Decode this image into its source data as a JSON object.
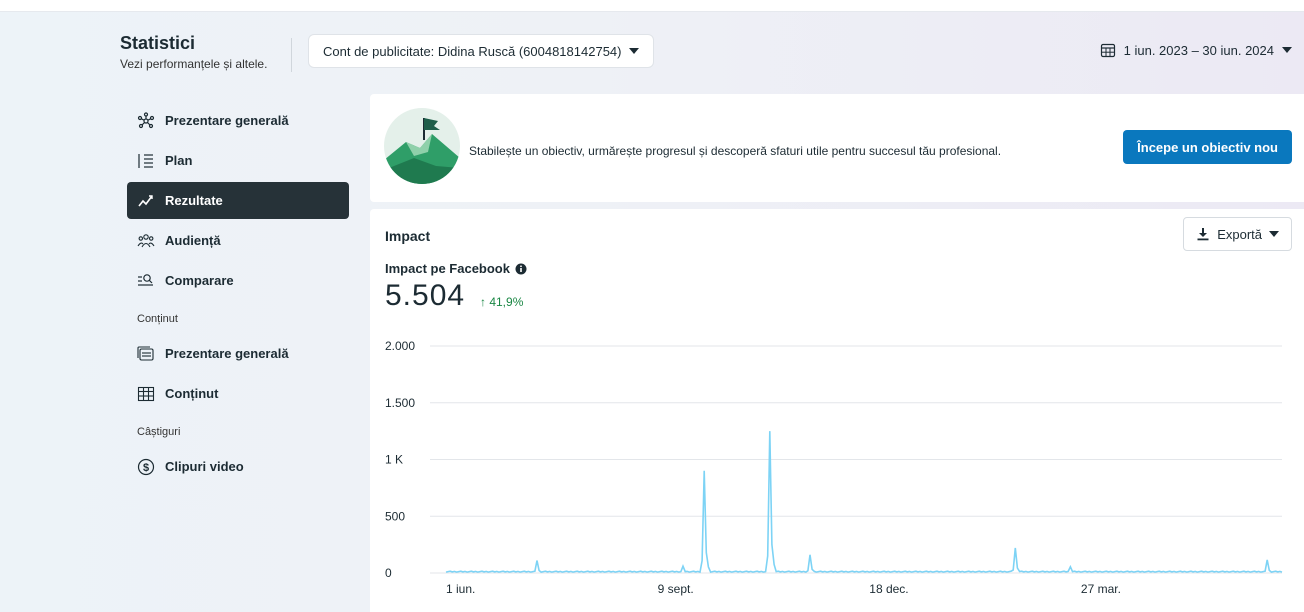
{
  "header": {
    "title": "Statistici",
    "subtitle": "Vezi performanțele și altele.",
    "account_label": "Cont de publicitate: Didina Ruscă (6004818142754)",
    "date_range": "1 iun. 2023 – 30 iun. 2024"
  },
  "sidebar": {
    "items": [
      {
        "label": "Prezentare generală",
        "icon": "nodes-icon",
        "active": false
      },
      {
        "label": "Plan",
        "icon": "list-icon",
        "active": false
      },
      {
        "label": "Rezultate",
        "icon": "trend-icon",
        "active": true
      },
      {
        "label": "Audiență",
        "icon": "people-icon",
        "active": false
      },
      {
        "label": "Comparare",
        "icon": "compare-icon",
        "active": false
      }
    ],
    "sections": [
      {
        "label": "Conținut",
        "items": [
          {
            "label": "Prezentare generală",
            "icon": "content-overview-icon"
          },
          {
            "label": "Conținut",
            "icon": "table-icon"
          }
        ]
      },
      {
        "label": "Câștiguri",
        "items": [
          {
            "label": "Clipuri video",
            "icon": "dollar-icon"
          }
        ]
      }
    ]
  },
  "goal": {
    "text": "Stabilește un obiectiv, urmărește progresul și descoperă sfaturi utile pentru succesul tău profesional.",
    "button_label": "Începe un obiectiv nou"
  },
  "impact": {
    "title": "Impact",
    "export_label": "Exportă",
    "metric_label": "Impact pe Facebook",
    "metric_value": "5.504",
    "metric_change": "↑ 41,9%"
  },
  "colors": {
    "accent": "#0a78be",
    "active_nav": "#263238",
    "line": "#7dd3f5",
    "positive": "#1a8744"
  },
  "chart_data": {
    "type": "line",
    "title": "",
    "xlabel": "",
    "ylabel": "",
    "ylim": [
      0,
      2000
    ],
    "y_ticks": [
      0,
      500,
      1000,
      1500,
      2000
    ],
    "y_tick_labels": [
      "0",
      "500",
      "1 K",
      "1.500",
      "2.000"
    ],
    "x_tick_labels": [
      "1 iun.",
      "9 sept.",
      "18 dec.",
      "27 mar."
    ],
    "x_tick_days": [
      0,
      100,
      200,
      300
    ],
    "x_days": 395,
    "baseline": 8,
    "spikes": [
      {
        "day": 43,
        "value": 110
      },
      {
        "day": 112,
        "value": 60
      },
      {
        "day": 122,
        "value": 900
      },
      {
        "day": 153,
        "value": 1250
      },
      {
        "day": 172,
        "value": 160
      },
      {
        "day": 269,
        "value": 220
      },
      {
        "day": 295,
        "value": 55
      },
      {
        "day": 388,
        "value": 115
      }
    ]
  }
}
